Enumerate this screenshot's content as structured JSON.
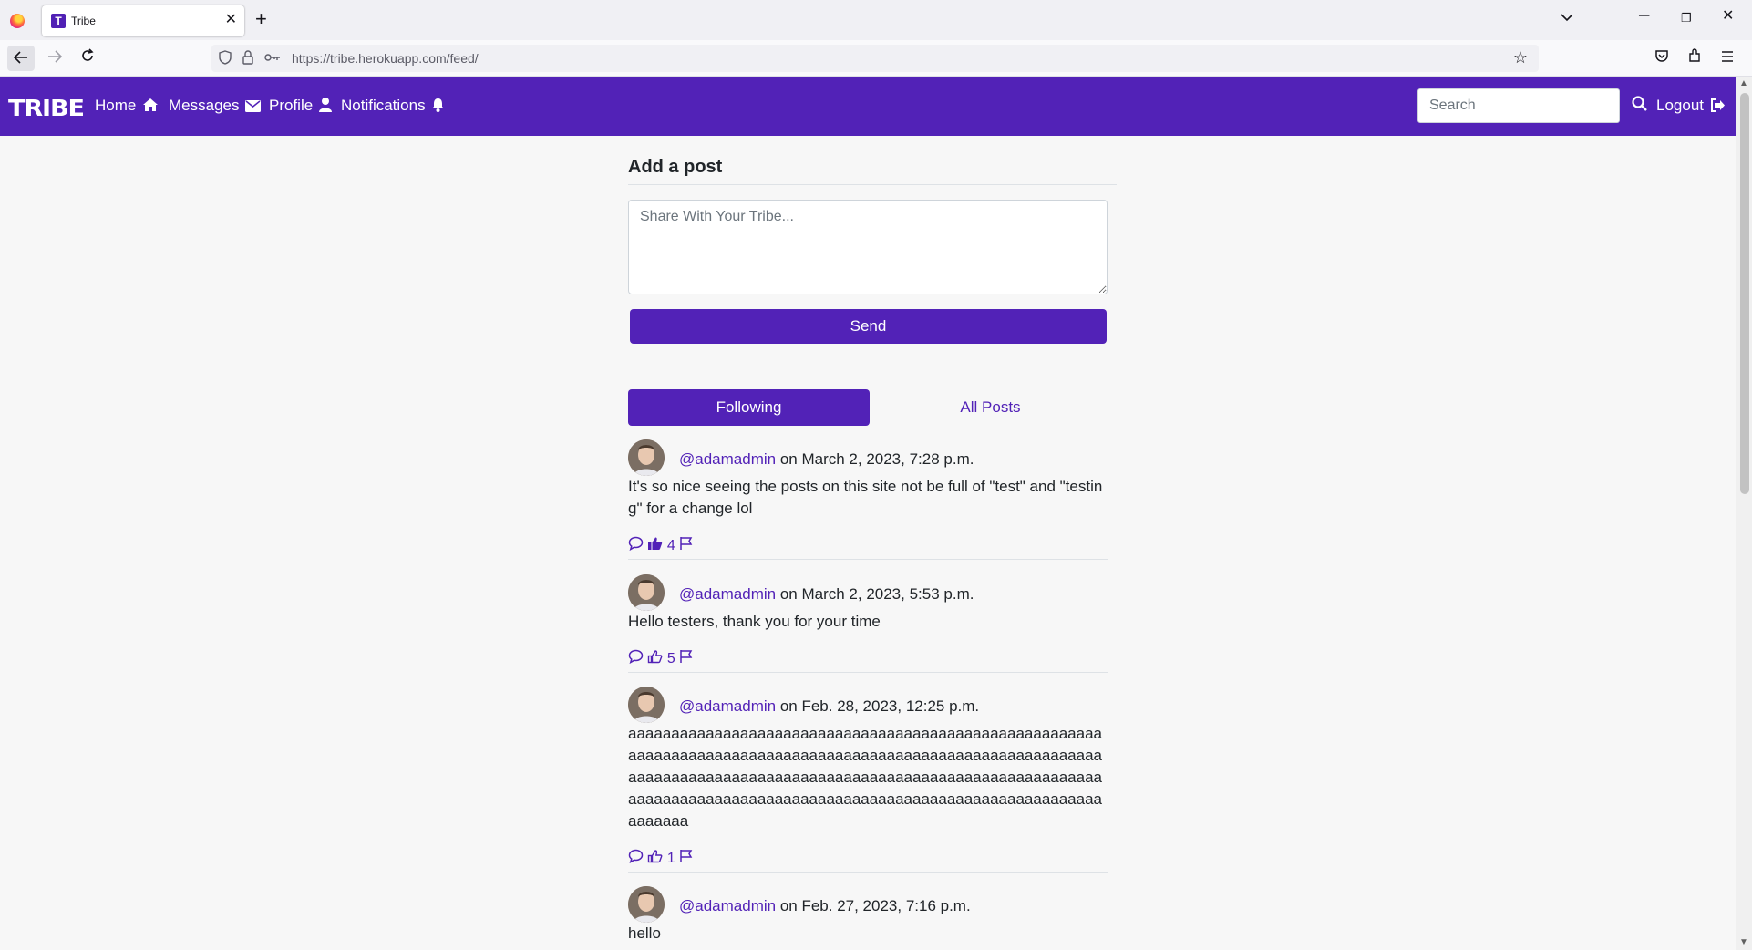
{
  "browser": {
    "tab_title": "Tribe",
    "tab_favicon_letter": "T",
    "url": "https://tribe.herokuapp.com/feed/"
  },
  "site": {
    "brand": "TRIBE",
    "nav": {
      "home": "Home",
      "messages": "Messages",
      "profile": "Profile",
      "notifications": "Notifications",
      "logout": "Logout"
    },
    "search_placeholder": "Search",
    "accent_color": "#5222b7"
  },
  "composer": {
    "title": "Add a post",
    "placeholder": "Share With Your Tribe...",
    "send_label": "Send"
  },
  "feed_tabs": {
    "following": "Following",
    "all_posts": "All Posts",
    "active": "following"
  },
  "posts": [
    {
      "author": "@adamadmin",
      "date": "on March 2, 2023, 7:28 p.m.",
      "body": "It's so nice seeing the posts on this site not be full of \"test\" and \"testing\" for a change lol",
      "likes": "4",
      "liked": true
    },
    {
      "author": "@adamadmin",
      "date": "on March 2, 2023, 5:53 p.m.",
      "body": "Hello testers, thank you for your time",
      "likes": "5",
      "liked": false
    },
    {
      "author": "@adamadmin",
      "date": "on Feb. 28, 2023, 12:25 p.m.",
      "body": "aaaaaaaaaaaaaaaaaaaaaaaaaaaaaaaaaaaaaaaaaaaaaaaaaaaaaaaaaaaaaaaaaaaaaaaaaaaaaaaaaaaaaaaaaaaaaaaaaaaaaaaaaaaaaaaaaaaaaaaaaaaaaaaaaaaaaaaaaaaaaaaaaaaaaaaaaaaaaaaaaaaaaaaaaaaaaaaaaaaaaaaaaaaaaaaaaaaaaaaaaaaaaaaaaaaaaaaaaaaaaaaaaaa",
      "likes": "1",
      "liked": false
    },
    {
      "author": "@adamadmin",
      "date": "on Feb. 27, 2023, 7:16 p.m.",
      "body": "hello",
      "likes": "",
      "liked": false
    }
  ]
}
